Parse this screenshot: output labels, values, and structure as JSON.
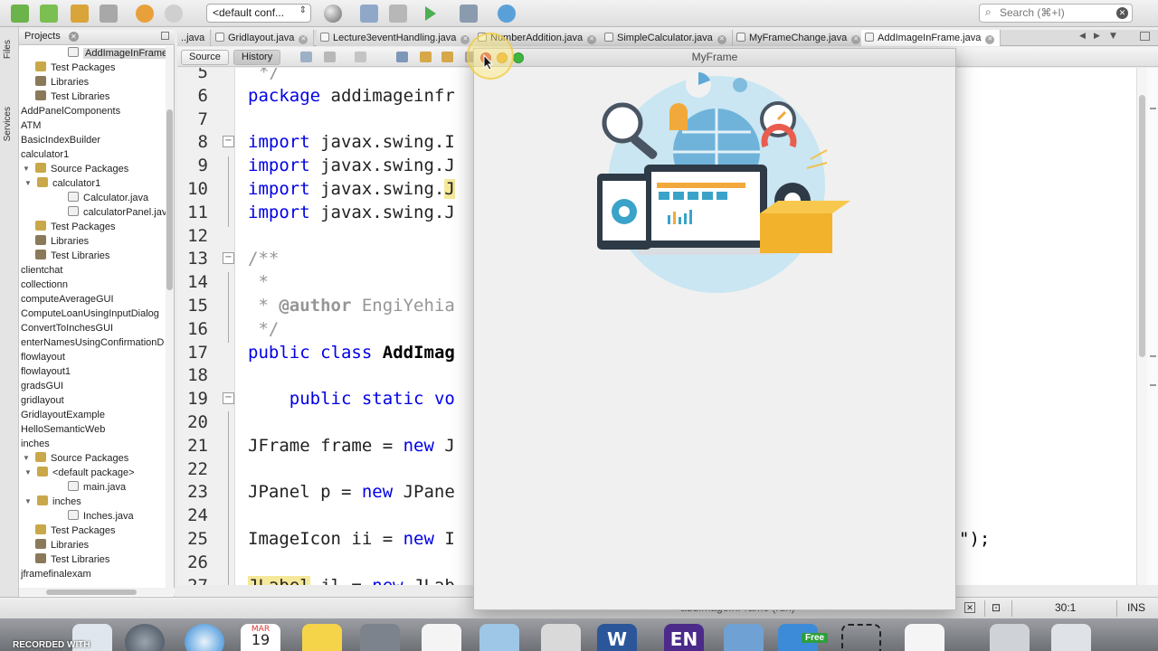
{
  "toolbar": {
    "config_label": "<default conf...",
    "search_placeholder": "Search (⌘+I)"
  },
  "side_strip": {
    "files_label": "Files",
    "services_label": "Services"
  },
  "projects": {
    "tab_label": "Projects",
    "tree": [
      {
        "label": "AddImageInFrame.ja",
        "depth": 3,
        "icon": "java",
        "selected": true
      },
      {
        "label": "Test Packages",
        "depth": 1,
        "icon": "pkg"
      },
      {
        "label": "Libraries",
        "depth": 1,
        "icon": "lib"
      },
      {
        "label": "Test Libraries",
        "depth": 1,
        "icon": "lib"
      },
      {
        "label": "AddPanelComponents",
        "depth": 0,
        "icon": "proj"
      },
      {
        "label": "ATM",
        "depth": 0,
        "icon": "proj"
      },
      {
        "label": "BasicIndexBuilder",
        "depth": 0,
        "icon": "proj"
      },
      {
        "label": "calculator1",
        "depth": 0,
        "icon": "proj"
      },
      {
        "label": "Source Packages",
        "depth": 1,
        "icon": "pkg",
        "expanded": true
      },
      {
        "label": "calculator1",
        "depth": 2,
        "icon": "pkg",
        "expanded": true
      },
      {
        "label": "Calculator.java",
        "depth": 3,
        "icon": "java"
      },
      {
        "label": "calculatorPanel.java",
        "depth": 3,
        "icon": "java"
      },
      {
        "label": "Test Packages",
        "depth": 1,
        "icon": "pkg"
      },
      {
        "label": "Libraries",
        "depth": 1,
        "icon": "lib"
      },
      {
        "label": "Test Libraries",
        "depth": 1,
        "icon": "lib"
      },
      {
        "label": "clientchat",
        "depth": 0,
        "icon": "proj"
      },
      {
        "label": "collectionn",
        "depth": 0,
        "icon": "proj"
      },
      {
        "label": "computeAverageGUI",
        "depth": 0,
        "icon": "proj"
      },
      {
        "label": "ComputeLoanUsingInputDialog",
        "depth": 0,
        "icon": "proj"
      },
      {
        "label": "ConvertToInchesGUI",
        "depth": 0,
        "icon": "proj"
      },
      {
        "label": "enterNamesUsingConfirmationD",
        "depth": 0,
        "icon": "proj"
      },
      {
        "label": "flowlayout",
        "depth": 0,
        "icon": "proj"
      },
      {
        "label": "flowlayout1",
        "depth": 0,
        "icon": "proj"
      },
      {
        "label": "gradsGUI",
        "depth": 0,
        "icon": "proj"
      },
      {
        "label": "gridlayout",
        "depth": 0,
        "icon": "proj"
      },
      {
        "label": "GridlayoutExample",
        "depth": 0,
        "icon": "proj"
      },
      {
        "label": "HelloSemanticWeb",
        "depth": 0,
        "icon": "proj"
      },
      {
        "label": "inches",
        "depth": 0,
        "icon": "proj"
      },
      {
        "label": "Source Packages",
        "depth": 1,
        "icon": "pkg",
        "expanded": true
      },
      {
        "label": "<default package>",
        "depth": 2,
        "icon": "pkg",
        "expanded": true
      },
      {
        "label": "main.java",
        "depth": 3,
        "icon": "java"
      },
      {
        "label": "inches",
        "depth": 2,
        "icon": "pkg",
        "expanded": true
      },
      {
        "label": "Inches.java",
        "depth": 3,
        "icon": "java"
      },
      {
        "label": "Test Packages",
        "depth": 1,
        "icon": "pkg"
      },
      {
        "label": "Libraries",
        "depth": 1,
        "icon": "lib"
      },
      {
        "label": "Test Libraries",
        "depth": 1,
        "icon": "lib"
      },
      {
        "label": "jframefinalexam",
        "depth": 0,
        "icon": "proj"
      }
    ]
  },
  "editor_tabs": [
    {
      "label": "..java",
      "active": false,
      "closable": false
    },
    {
      "label": "Gridlayout.java",
      "active": false,
      "closable": true
    },
    {
      "label": "Lecture3eventHandling.java",
      "active": false,
      "closable": true
    },
    {
      "label": "NumberAddition.java",
      "active": false,
      "closable": true
    },
    {
      "label": "SimpleCalculator.java",
      "active": false,
      "closable": true
    },
    {
      "label": "MyFrameChange.java",
      "active": false,
      "closable": true
    },
    {
      "label": "AddImageInFrame.java",
      "active": true,
      "closable": true
    }
  ],
  "editor_sub": {
    "source_label": "Source",
    "history_label": "History"
  },
  "code_lines": [
    {
      "n": "5",
      "segs": [
        {
          "t": "*/",
          "c": "cm"
        }
      ],
      "indent": 1
    },
    {
      "n": "6",
      "segs": [
        {
          "t": "package",
          "c": "kw"
        },
        {
          "t": " addimageinfr",
          "c": ""
        }
      ]
    },
    {
      "n": "7",
      "segs": []
    },
    {
      "n": "8",
      "segs": [
        {
          "t": "import",
          "c": "kw"
        },
        {
          "t": " javax.swing.I",
          "c": ""
        }
      ],
      "fold": "−"
    },
    {
      "n": "9",
      "segs": [
        {
          "t": "import",
          "c": "kw"
        },
        {
          "t": " javax.swing.J",
          "c": ""
        }
      ]
    },
    {
      "n": "10",
      "segs": [
        {
          "t": "import",
          "c": "kw"
        },
        {
          "t": " javax.swing.",
          "c": ""
        },
        {
          "t": "J",
          "c": "hl"
        }
      ]
    },
    {
      "n": "11",
      "segs": [
        {
          "t": "import",
          "c": "kw"
        },
        {
          "t": " javax.swing.J",
          "c": ""
        }
      ]
    },
    {
      "n": "12",
      "segs": []
    },
    {
      "n": "13",
      "segs": [
        {
          "t": "/**",
          "c": "cm"
        }
      ],
      "fold": "−"
    },
    {
      "n": "14",
      "segs": [
        {
          "t": " *",
          "c": "cm"
        }
      ]
    },
    {
      "n": "15",
      "segs": [
        {
          "t": " * ",
          "c": "cm"
        },
        {
          "t": "@author",
          "c": "cmb"
        },
        {
          "t": " EngiYehia",
          "c": "cm"
        }
      ]
    },
    {
      "n": "16",
      "segs": [
        {
          "t": " */",
          "c": "cm"
        }
      ]
    },
    {
      "n": "17",
      "segs": [
        {
          "t": "public",
          "c": "kw"
        },
        {
          "t": " ",
          "c": ""
        },
        {
          "t": "class",
          "c": "kw"
        },
        {
          "t": " ",
          "c": ""
        },
        {
          "t": "AddImag",
          "c": "cls"
        }
      ]
    },
    {
      "n": "18",
      "segs": []
    },
    {
      "n": "19",
      "segs": [
        {
          "t": "    ",
          "c": ""
        },
        {
          "t": "public",
          "c": "kw"
        },
        {
          "t": " ",
          "c": ""
        },
        {
          "t": "static",
          "c": "kw"
        },
        {
          "t": " ",
          "c": ""
        },
        {
          "t": "vo",
          "c": "kw"
        }
      ],
      "fold": "−"
    },
    {
      "n": "20",
      "segs": []
    },
    {
      "n": "21",
      "segs": [
        {
          "t": "JFrame frame = ",
          "c": ""
        },
        {
          "t": "new",
          "c": "kw"
        },
        {
          "t": " J",
          "c": ""
        }
      ]
    },
    {
      "n": "22",
      "segs": []
    },
    {
      "n": "23",
      "segs": [
        {
          "t": "JPanel p = ",
          "c": ""
        },
        {
          "t": "new",
          "c": "kw"
        },
        {
          "t": " JPane",
          "c": ""
        }
      ]
    },
    {
      "n": "24",
      "segs": []
    },
    {
      "n": "25",
      "segs": [
        {
          "t": "ImageIcon ii = ",
          "c": ""
        },
        {
          "t": "new",
          "c": "kw"
        },
        {
          "t": " I",
          "c": ""
        }
      ],
      "tail": "\");"
    },
    {
      "n": "26",
      "segs": []
    },
    {
      "n": "27",
      "segs": [
        {
          "t": "JLabel",
          "c": "hl"
        },
        {
          "t": " jl = ",
          "c": ""
        },
        {
          "t": "new",
          "c": "kw"
        },
        {
          "t": " JLab",
          "c": ""
        }
      ]
    }
  ],
  "status": {
    "position": "30:1",
    "mode": "INS",
    "task": "addImageInFrame (run)"
  },
  "window": {
    "title": "MyFrame"
  },
  "dock": {
    "recorded_label": "RECORDED WITH",
    "calendar_month": "MAR",
    "calendar_day": "19",
    "word_letter": "W",
    "en_label": "EN",
    "free_label": "Free"
  },
  "colors": {
    "keyword": "#0000e6",
    "comment": "#969696",
    "highlight": "#f5e89a",
    "window_bg": "#f0f0f0",
    "illustration_circle": "#c9e6f2"
  }
}
